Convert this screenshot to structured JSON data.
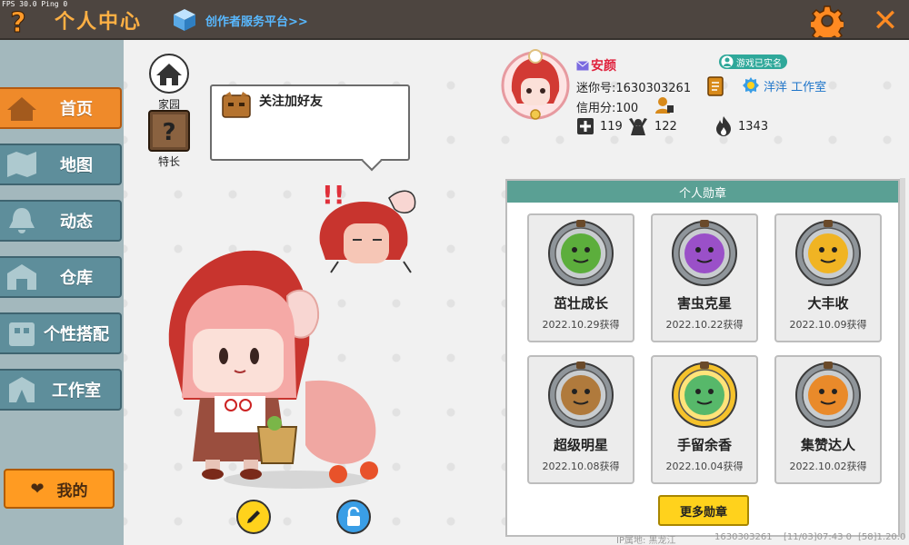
{
  "topbar": {
    "fps_label": "FPS 30.0  Ping 0",
    "title": "个人中心",
    "platform_link": "创作者服务平台>>"
  },
  "sidebar": {
    "items": [
      {
        "label": "首页",
        "icon": "house-icon",
        "active": true
      },
      {
        "label": "地图",
        "icon": "map-icon",
        "active": false
      },
      {
        "label": "动态",
        "icon": "bell-icon",
        "active": false
      },
      {
        "label": "仓库",
        "icon": "warehouse-icon",
        "active": false
      },
      {
        "label": "个性搭配",
        "icon": "outfit-icon",
        "active": false
      },
      {
        "label": "工作室",
        "icon": "studio-icon",
        "active": false
      }
    ],
    "mine_label": "我的"
  },
  "home_icons": {
    "home_label": "家园",
    "skill_label": "特长"
  },
  "speech": {
    "text": "关注加好友"
  },
  "profile": {
    "nickname": "安颜",
    "mini_id": "迷你号:1630303261",
    "credit": "信用分:100",
    "verified": "游戏已实名",
    "studio": "洋洋 工作室",
    "stats": {
      "adds": "119",
      "likes": "122",
      "heat": "1343"
    }
  },
  "medals": {
    "title": "个人勋章",
    "more_label": "更多勋章",
    "items": [
      {
        "name": "茁壮成长",
        "date": "2022.10.29获得",
        "color": "#5cae3c"
      },
      {
        "name": "害虫克星",
        "date": "2022.10.22获得",
        "color": "#9a50c8"
      },
      {
        "name": "大丰收",
        "date": "2022.10.09获得",
        "color": "#f0b423"
      },
      {
        "name": "超级明星",
        "date": "2022.10.08获得",
        "color": "#b07a3c"
      },
      {
        "name": "手留余香",
        "date": "2022.10.04获得",
        "color": "#57b86a"
      },
      {
        "name": "集赞达人",
        "date": "2022.10.02获得",
        "color": "#e98a2a"
      }
    ]
  },
  "footer": {
    "ip": "IP属地: 黑龙江",
    "uid": "1630303261",
    "time": "[11/03]07:43 0",
    "version": "[58]1.20.0"
  },
  "colors": {
    "accent_orange": "#ef8a2a",
    "sidebar_teal": "#5e8e9b",
    "panel_header": "#5aa094",
    "nickname_red": "#e0223d"
  }
}
